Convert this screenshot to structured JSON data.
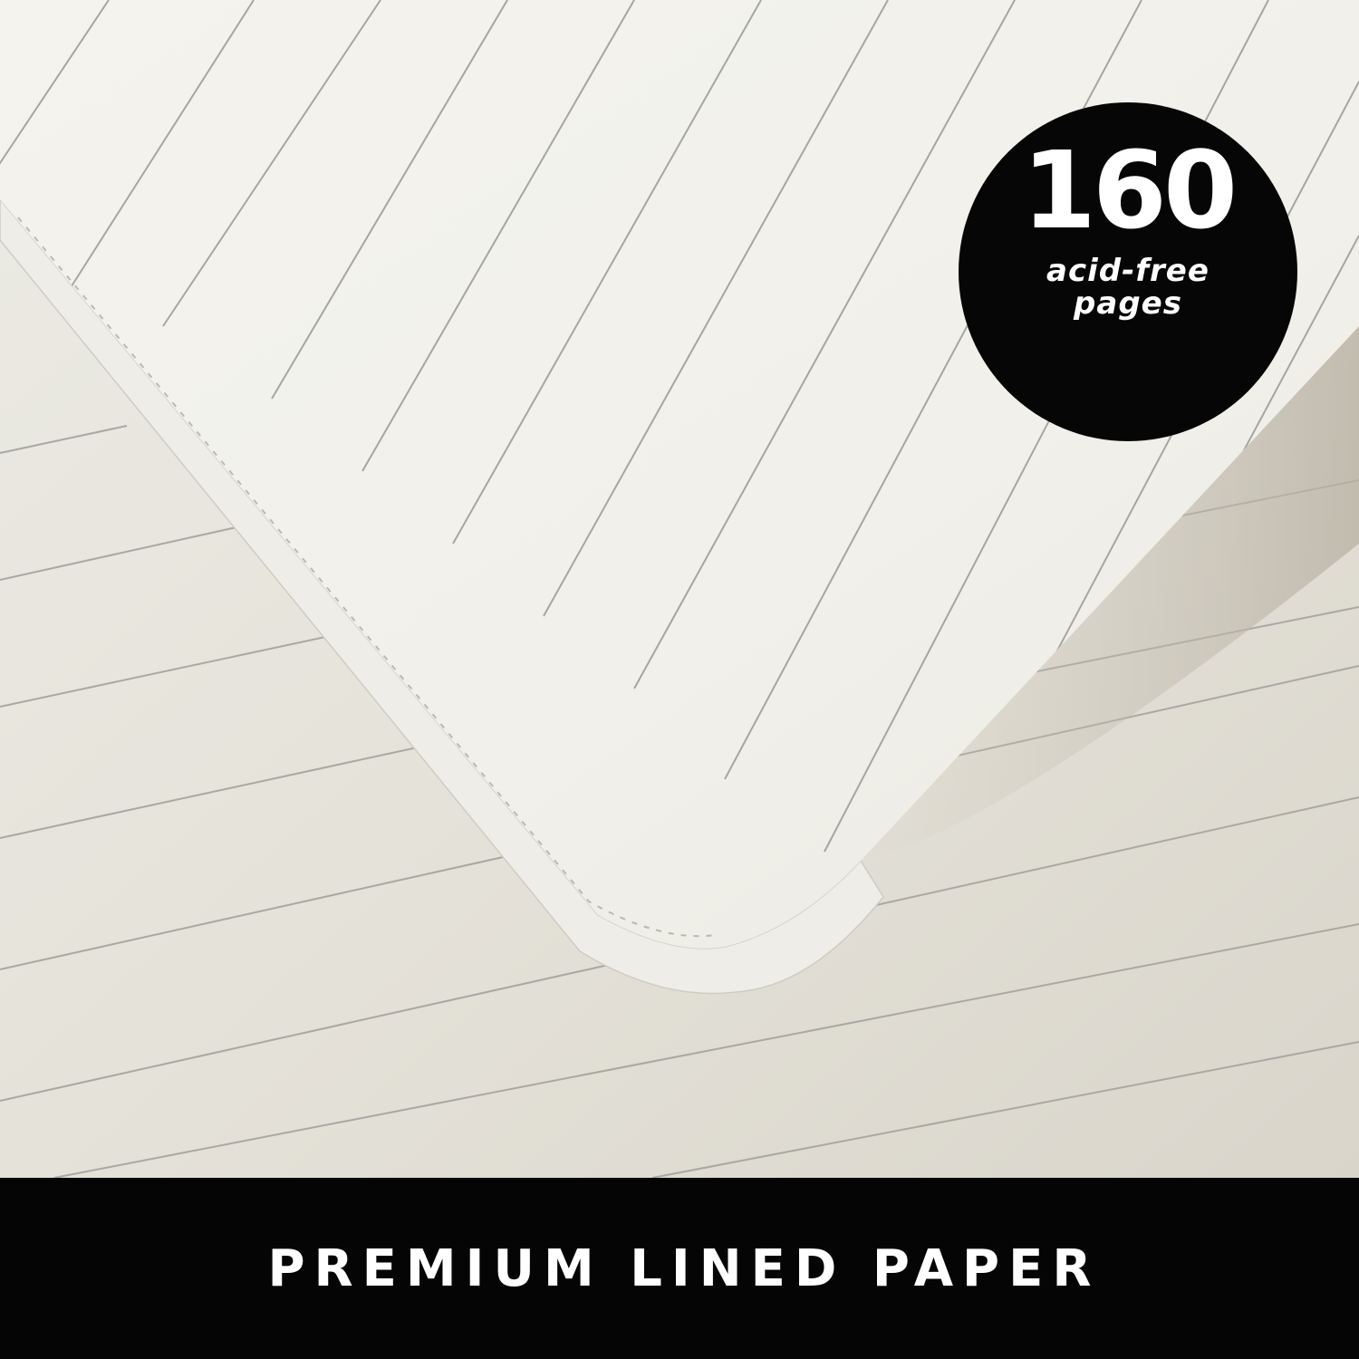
{
  "badge": {
    "number": "160",
    "caption_line1": "acid-free",
    "caption_line2": "pages"
  },
  "banner": {
    "text": "PREMIUM LINED PAPER"
  },
  "colors": {
    "paper": "#f3f1ea",
    "background_paper": "#e6e3da",
    "rule_line": "#a8a8a3",
    "badge": "#060606",
    "banner": "#050505",
    "text_on_dark": "#ffffff"
  }
}
